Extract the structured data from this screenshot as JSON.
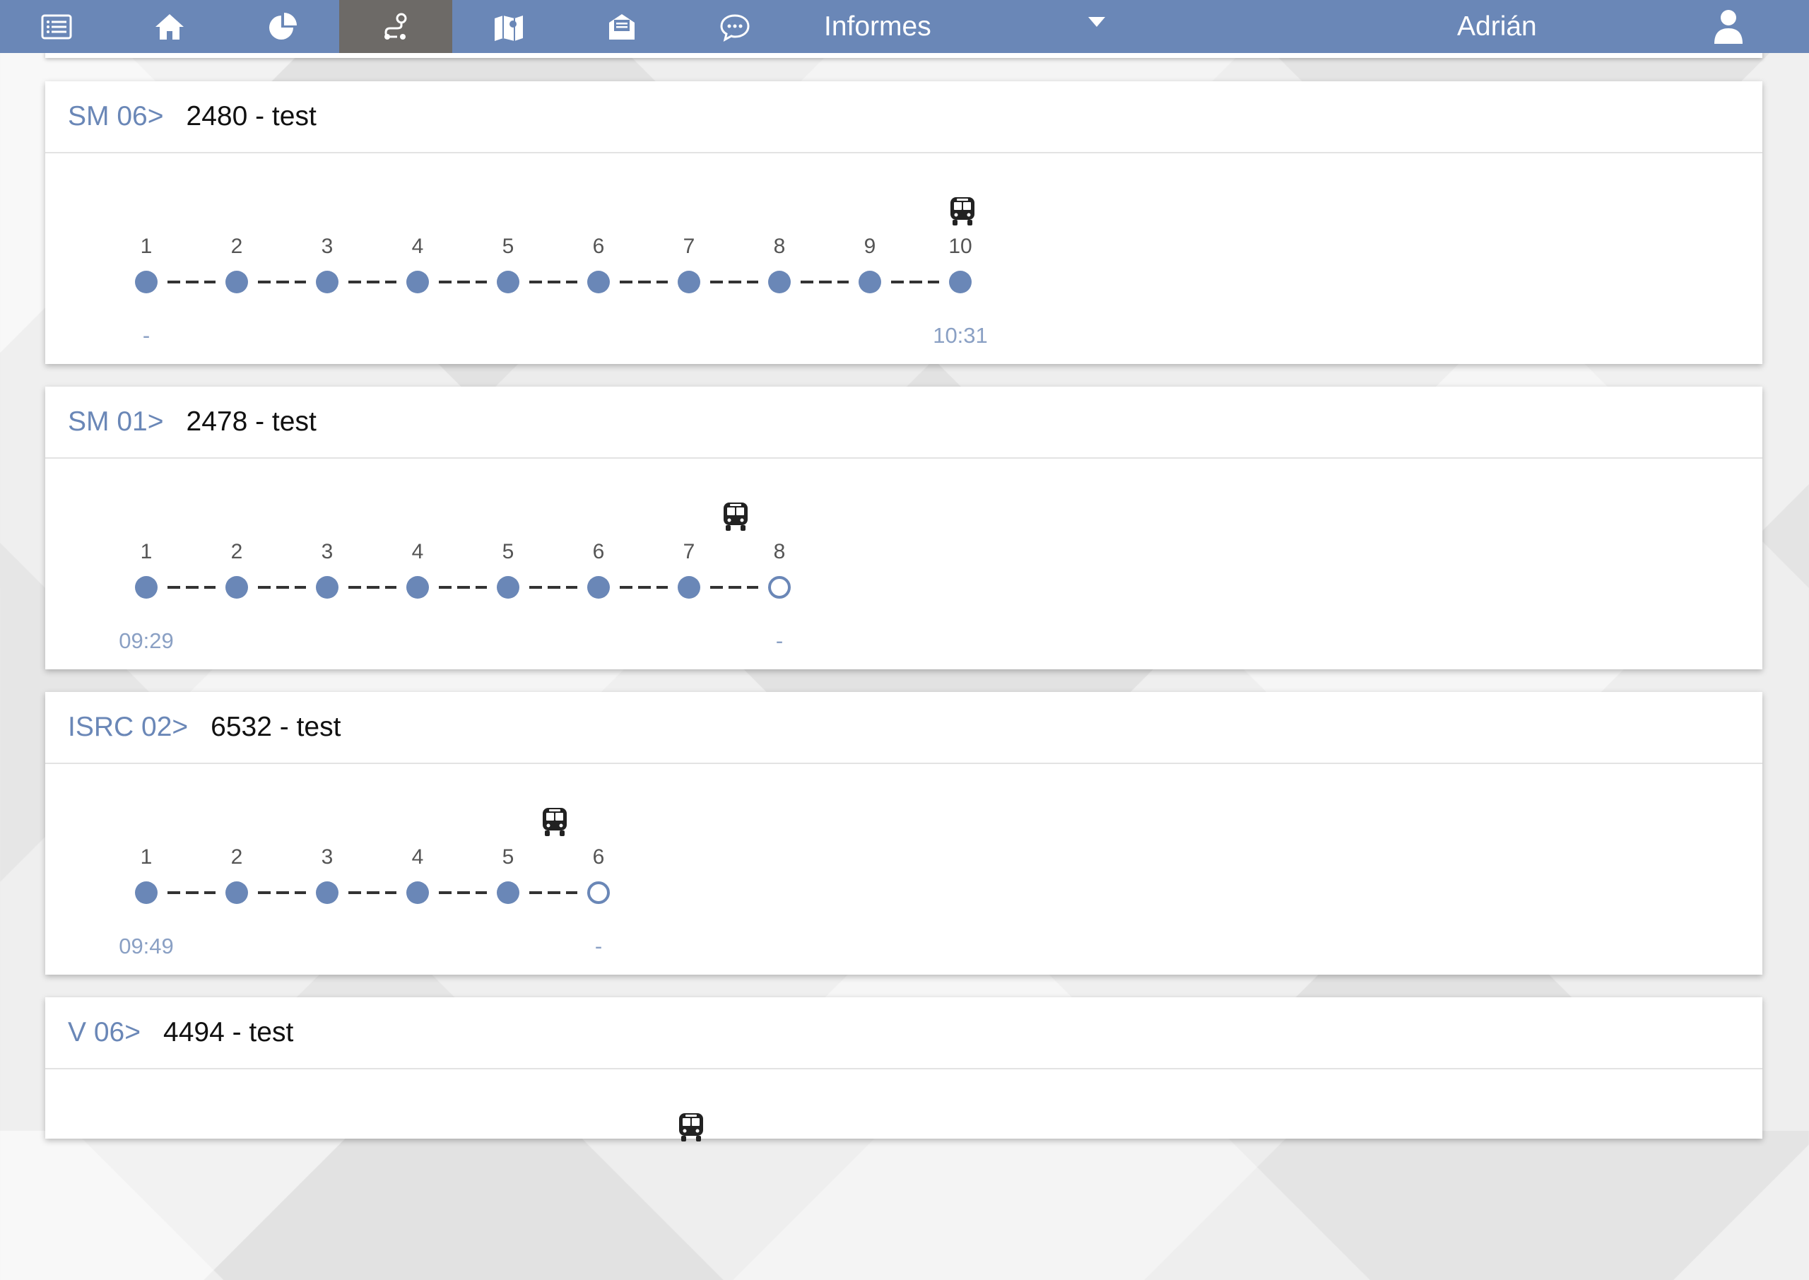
{
  "header": {
    "title": "Informes",
    "user": "Adrián",
    "nav": [
      {
        "icon": "list-icon"
      },
      {
        "icon": "home-icon"
      },
      {
        "icon": "pie-chart-icon"
      },
      {
        "icon": "route-icon",
        "active": true
      },
      {
        "icon": "map-icon"
      },
      {
        "icon": "mail-icon"
      },
      {
        "icon": "chat-icon"
      }
    ]
  },
  "colors": {
    "accent": "#6a87b7",
    "active_tab": "#6d6a67"
  },
  "routes": [
    {
      "code": "SM 06>",
      "name": "2480 - test",
      "stops": [
        "1",
        "2",
        "3",
        "4",
        "5",
        "6",
        "7",
        "8",
        "9",
        "10"
      ],
      "visited": 10,
      "bus_between": [
        9,
        10
      ],
      "start_time": "-",
      "end_time": "10:31"
    },
    {
      "code": "SM 01>",
      "name": "2478 - test",
      "stops": [
        "1",
        "2",
        "3",
        "4",
        "5",
        "6",
        "7",
        "8"
      ],
      "visited": 7,
      "bus_between": [
        7,
        8
      ],
      "start_time": "09:29",
      "end_time": "-"
    },
    {
      "code": "ISRC 02>",
      "name": "6532 - test",
      "stops": [
        "1",
        "2",
        "3",
        "4",
        "5",
        "6"
      ],
      "visited": 5,
      "bus_between": [
        5,
        6
      ],
      "start_time": "09:49",
      "end_time": "-"
    },
    {
      "code": "V 06>",
      "name": "4494 - test",
      "stops": [],
      "visited": 0,
      "bus_between": [],
      "start_time": "",
      "end_time": ""
    }
  ]
}
